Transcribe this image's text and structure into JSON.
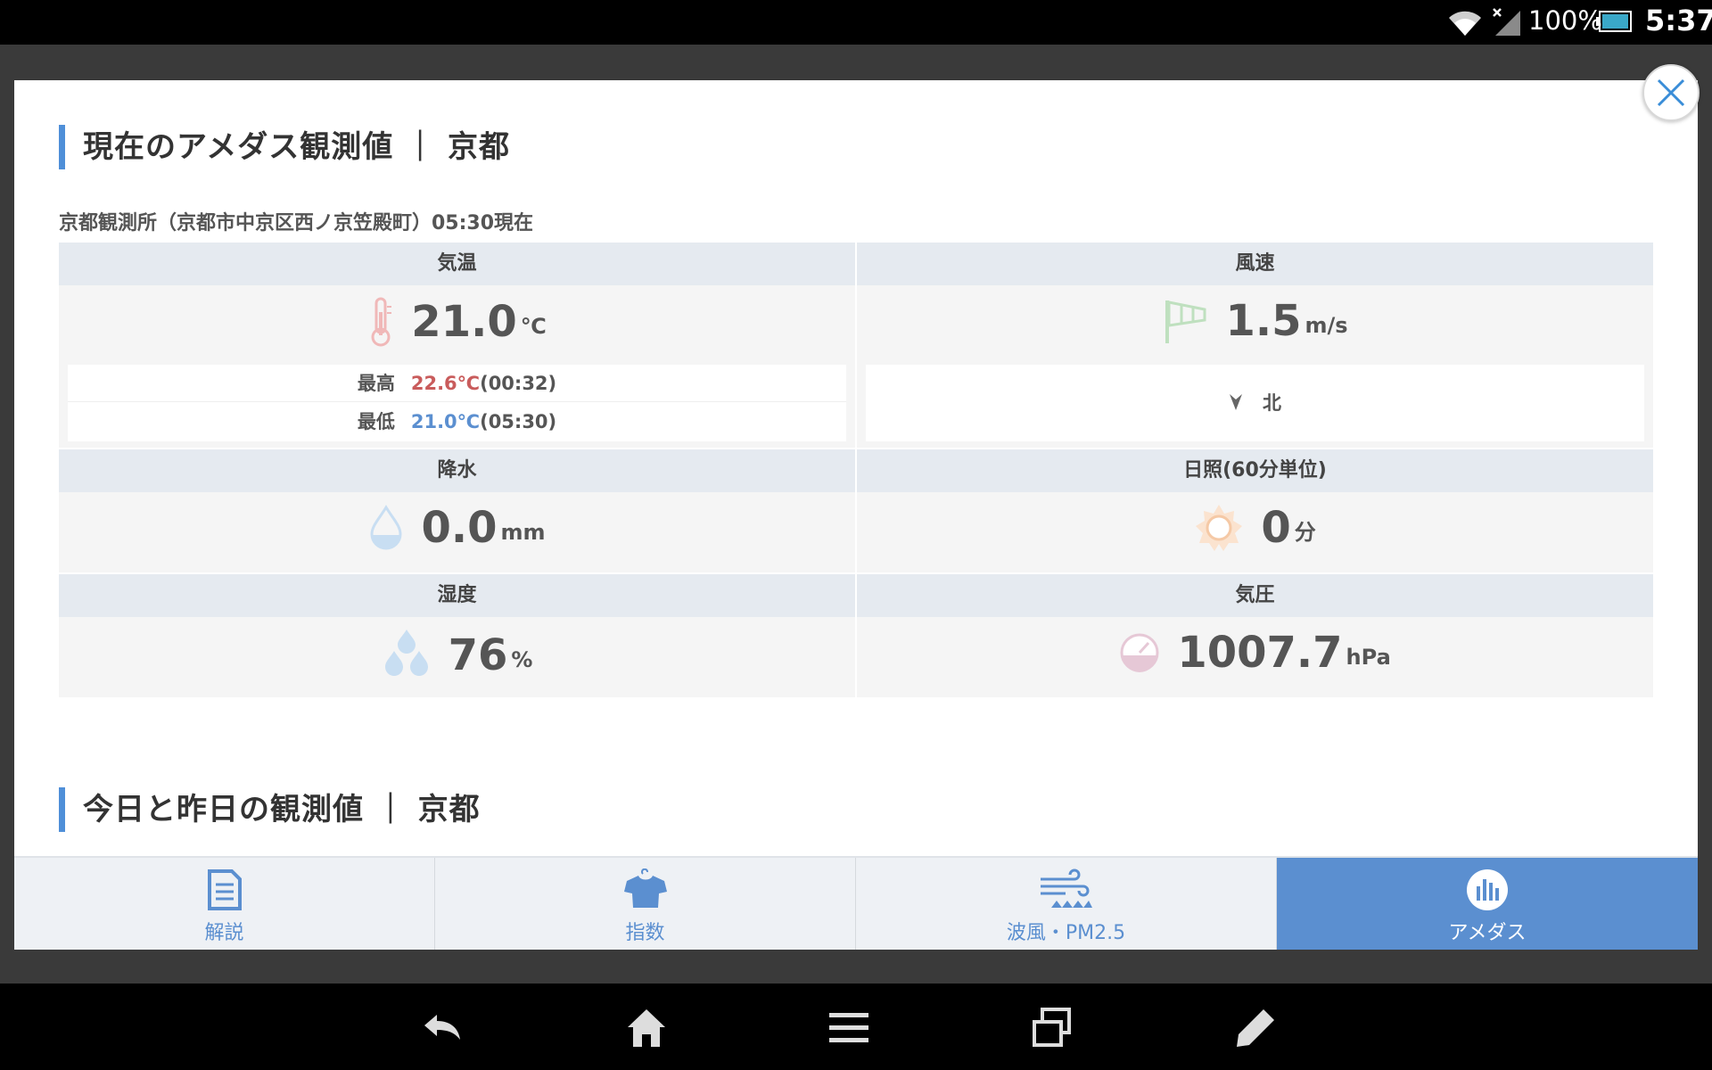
{
  "status_bar": {
    "battery_percent": "100%",
    "time": "5:37",
    "icons": [
      "wifi-icon",
      "signal-icon",
      "battery-icon"
    ]
  },
  "current": {
    "title": "現在のアメダス観測値 ｜ 京都",
    "station": "京都観測所（京都市中京区西ノ京笠殿町）05:30現在",
    "temperature": {
      "label": "気温",
      "value": "21.0",
      "unit": "℃",
      "max_label": "最高",
      "max_value": "22.6℃",
      "max_time": "(00:32)",
      "min_label": "最低",
      "min_value": "21.0℃",
      "min_time": "(05:30)"
    },
    "wind": {
      "label": "風速",
      "value": "1.5",
      "unit": "m/s",
      "direction": "北"
    },
    "precipitation": {
      "label": "降水",
      "value": "0.0",
      "unit": "mm"
    },
    "sunshine": {
      "label": "日照(60分単位)",
      "value": "0",
      "unit": "分"
    },
    "humidity": {
      "label": "湿度",
      "value": "76",
      "unit": "%"
    },
    "pressure": {
      "label": "気圧",
      "value": "1007.7",
      "unit": "hPa"
    }
  },
  "history": {
    "title": "今日と昨日の観測値 ｜ 京都"
  },
  "tabs": [
    {
      "label": "解説",
      "icon": "document-icon"
    },
    {
      "label": "指数",
      "icon": "shirt-icon"
    },
    {
      "label": "波風・PM2.5",
      "icon": "wave-wind-icon"
    },
    {
      "label": "アメダス",
      "icon": "bar-chart-icon",
      "active": true
    }
  ],
  "colors": {
    "accent": "#5b8fd0",
    "high": "#c95c5c",
    "low": "#5b8fd0"
  }
}
